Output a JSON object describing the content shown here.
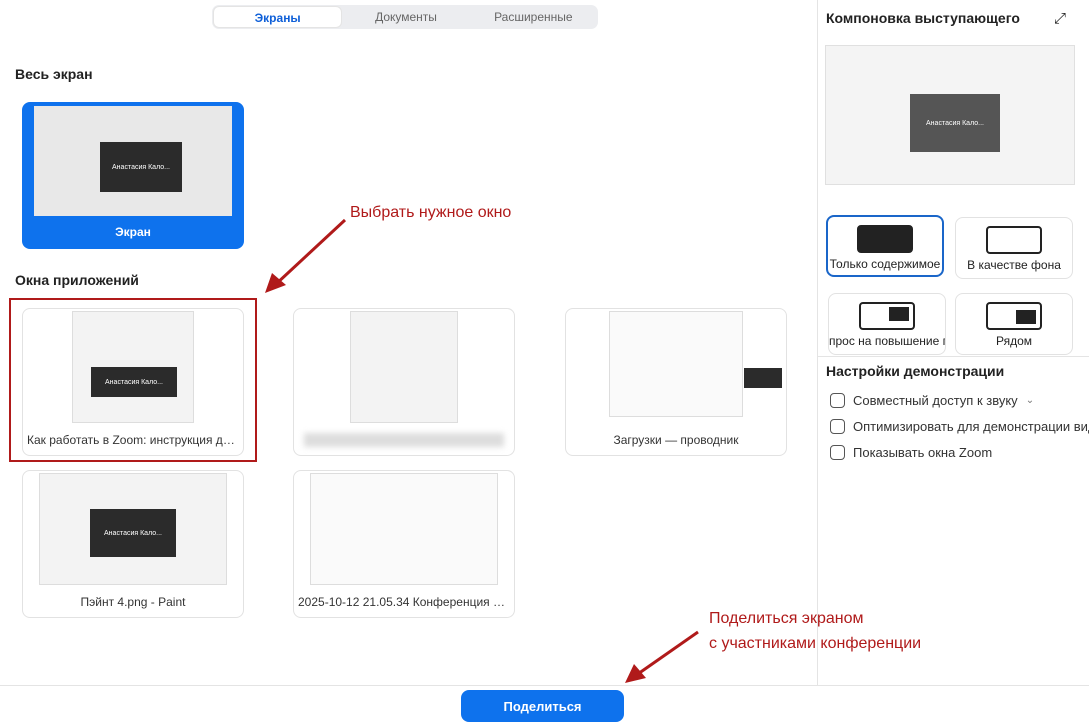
{
  "tabs": [
    "Экраны",
    "Документы",
    "Расширенные"
  ],
  "sections": {
    "full_screen": "Весь экран",
    "app_windows": "Окна приложений"
  },
  "screen": {
    "label": "Экран",
    "thumb_text": "Анастасия Кало..."
  },
  "windows": [
    {
      "label": "Как работать в Zoom: инструкция для...",
      "thumb_text": "Анастасия Кало..."
    },
    {
      "label": ""
    },
    {
      "label": "Загрузки — проводник"
    },
    {
      "label": "Пэйнт 4.png - Paint",
      "thumb_text": "Анастасия Кало..."
    },
    {
      "label": "2025-10-12 21.05.34 Конференция Zoo..."
    }
  ],
  "annotations": {
    "choose": "Выбрать нужное окно",
    "share_line1": "Поделиться экраном",
    "share_line2": "с участниками конференции"
  },
  "right": {
    "title": "Компоновка выступающего",
    "preview_text": "Анастасия Кало...",
    "layouts": [
      "Только содержимое",
      "В качестве фона",
      "прос на повышение пр",
      "Рядом"
    ],
    "settings_title": "Настройки демонстрации",
    "options": [
      "Совместный доступ к звуку",
      "Оптимизировать для демонстрации вид",
      "Показывать окна Zoom"
    ]
  },
  "share_button": "Поделиться"
}
